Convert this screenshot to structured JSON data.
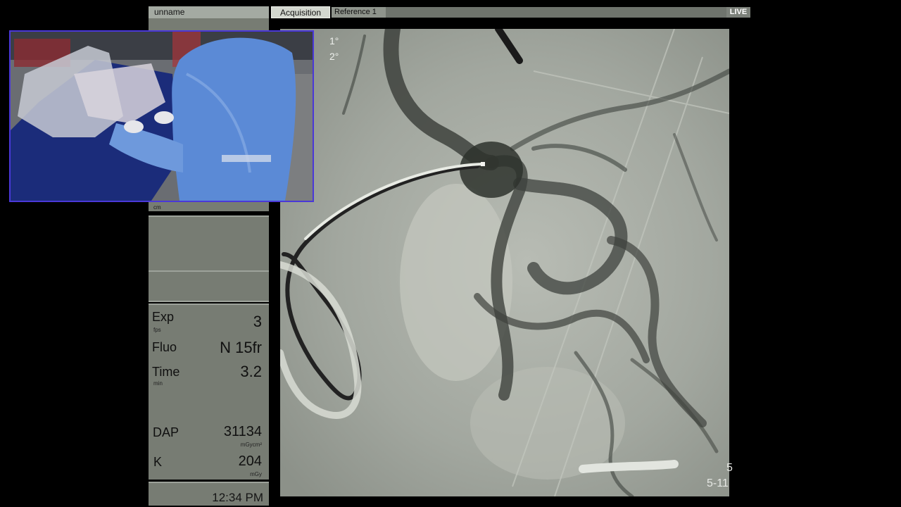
{
  "header": {
    "patient_name": "unname",
    "tabs": [
      {
        "label": "Acquisition",
        "active": true
      },
      {
        "label": "Reference 1",
        "active": false
      }
    ],
    "live_label": "LIVE"
  },
  "left_panel": {
    "cm_unit": "cm",
    "readouts": {
      "exp": {
        "label": "Exp",
        "unit": "fps",
        "value": "3"
      },
      "fluo": {
        "label": "Fluo",
        "value": "N 15fr"
      },
      "time": {
        "label": "Time",
        "unit": "min",
        "value": "3.2"
      },
      "dap": {
        "label": "DAP",
        "unit": "mGycm²",
        "value": "31134"
      },
      "k": {
        "label": "K",
        "unit": "mGy",
        "value": "204"
      }
    },
    "clock": "12:34 PM"
  },
  "image": {
    "angle_1": "1°",
    "angle_2": "2°",
    "frame_number": "5",
    "frame_id": "5-11"
  },
  "colors": {
    "panel": "#777c73",
    "video_border": "#4a38d8",
    "fluoro_bg": "#a8ada6"
  }
}
